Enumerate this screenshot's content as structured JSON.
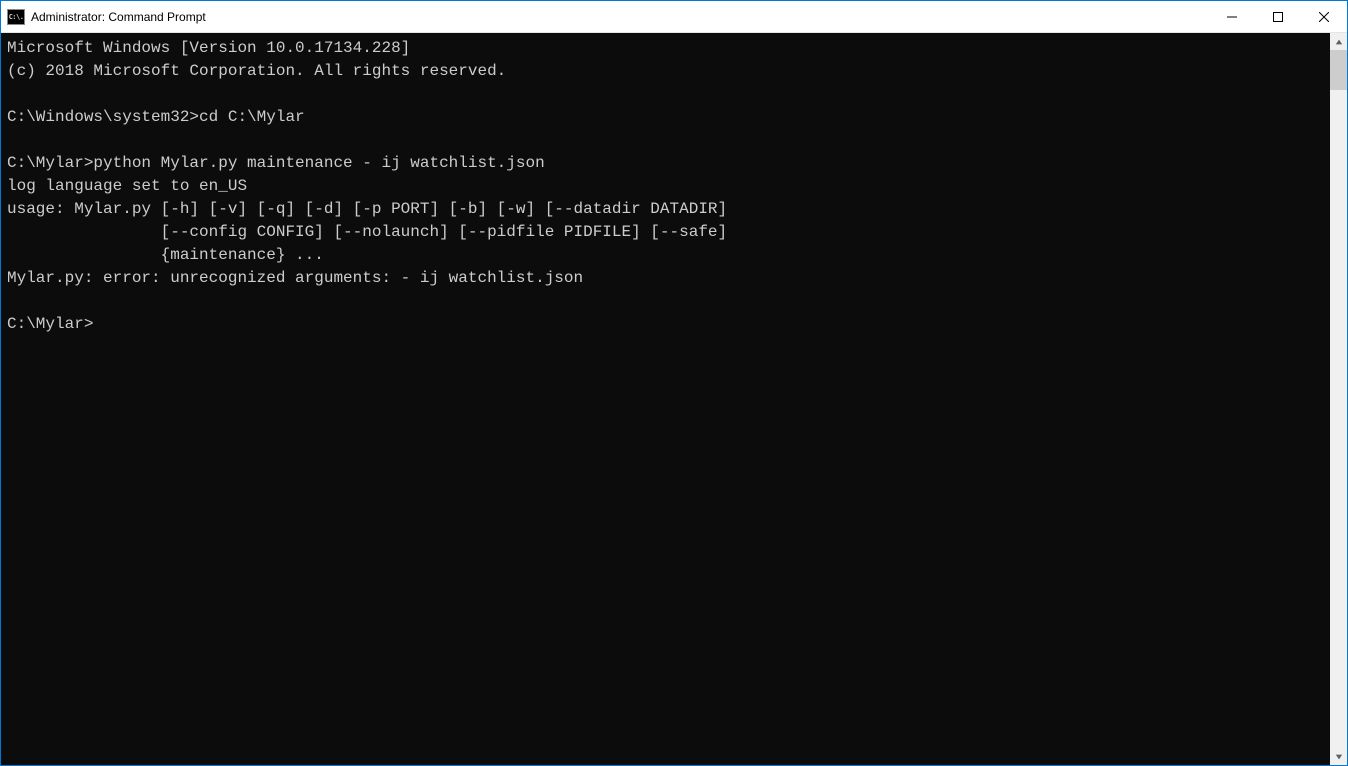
{
  "window": {
    "title": "Administrator: Command Prompt",
    "icon_text": "C:\\."
  },
  "terminal": {
    "lines": [
      "Microsoft Windows [Version 10.0.17134.228]",
      "(c) 2018 Microsoft Corporation. All rights reserved.",
      "",
      "C:\\Windows\\system32>cd C:\\Mylar",
      "",
      "C:\\Mylar>python Mylar.py maintenance - ij watchlist.json",
      "log language set to en_US",
      "usage: Mylar.py [-h] [-v] [-q] [-d] [-p PORT] [-b] [-w] [--datadir DATADIR]",
      "                [--config CONFIG] [--nolaunch] [--pidfile PIDFILE] [--safe]",
      "                {maintenance} ...",
      "Mylar.py: error: unrecognized arguments: - ij watchlist.json",
      "",
      "C:\\Mylar>"
    ]
  }
}
